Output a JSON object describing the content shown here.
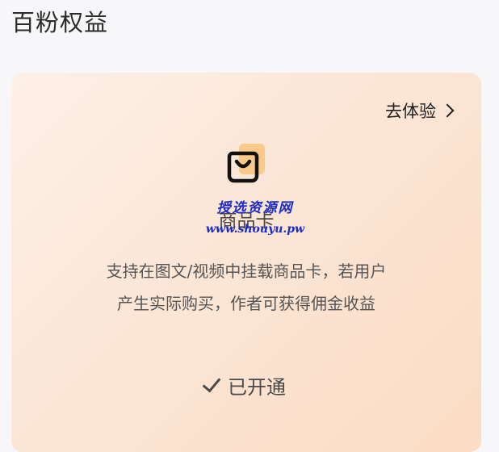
{
  "header": {
    "title": "百粉权益"
  },
  "card": {
    "try_label": "去体验",
    "icon": "shopping-bag-icon",
    "feature_title": "商品卡",
    "description_lines": [
      "支持在图文/视频中挂载商品卡，若用户",
      "产生实际购买，作者可获得佣金收益"
    ],
    "status_label": "已开通",
    "colors": {
      "gradient_start": "#fdf0e8",
      "gradient_end": "#fbdcc4",
      "icon_accent": "#f9c27a"
    }
  },
  "watermark": {
    "line1": "授选资源网",
    "line2": "www.shouyu.pw"
  }
}
